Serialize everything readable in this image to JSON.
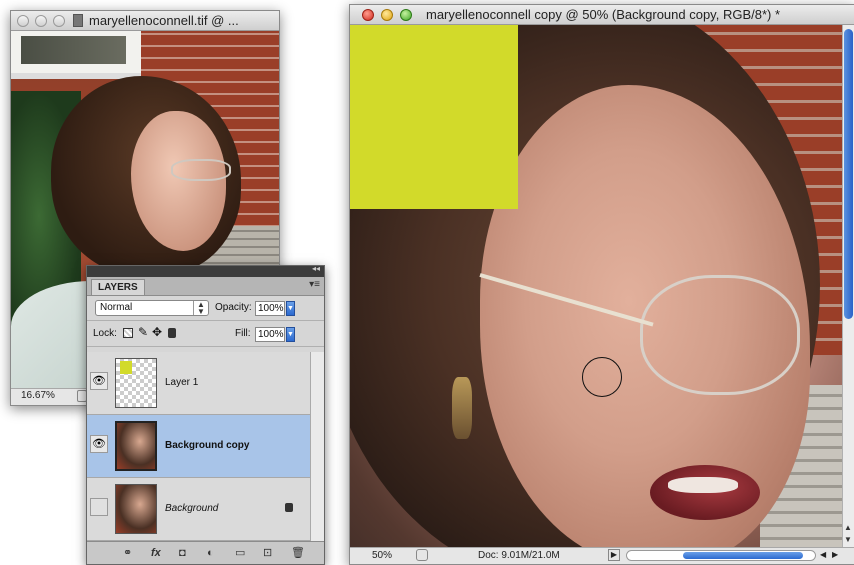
{
  "small_window": {
    "title": "maryellenoconnell.tif @ ...",
    "zoom": "16.67%"
  },
  "main_window": {
    "title": "maryellenoconnell copy @ 50% (Background copy, RGB/8*) *",
    "zoom": "50%",
    "doc_info": "Doc: 9.01M/21.0M"
  },
  "layers_panel": {
    "tab": "LAYERS",
    "blend_mode": "Normal",
    "opacity_label": "Opacity:",
    "opacity_value": "100%",
    "lock_label": "Lock:",
    "fill_label": "Fill:",
    "fill_value": "100%",
    "layers": [
      {
        "name": "Layer 1",
        "visible": true,
        "selected": false
      },
      {
        "name": "Background copy",
        "visible": true,
        "selected": true
      },
      {
        "name": "Background",
        "visible": false,
        "selected": false,
        "locked": true
      }
    ]
  },
  "colors": {
    "swatch": "#d2da2a",
    "selection": "#a8c4e8"
  },
  "icons": [
    "link-icon",
    "fx-icon",
    "mask-icon",
    "adjustment-icon",
    "folder-icon",
    "new-layer-icon",
    "trash-icon",
    "lock-icon",
    "eye-icon",
    "brush-icon",
    "move-icon",
    "transparency-lock-icon"
  ]
}
